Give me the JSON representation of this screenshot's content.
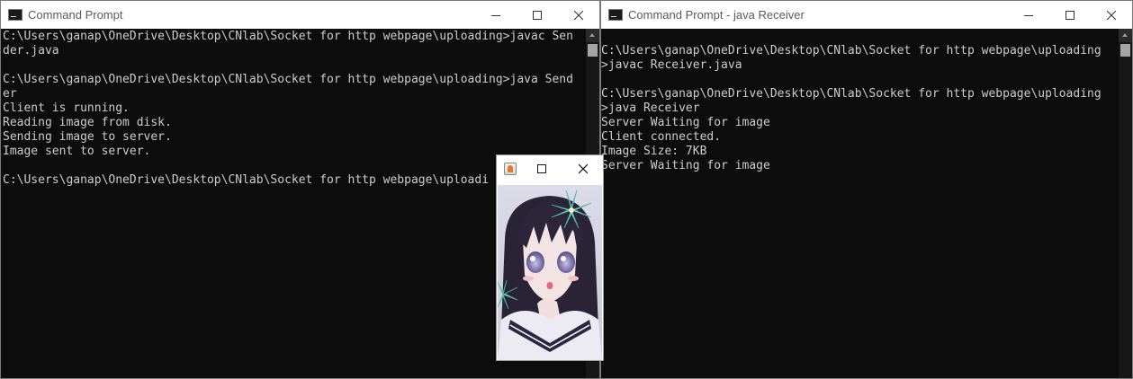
{
  "left_window": {
    "title": "Command Prompt",
    "lines": [
      "C:\\Users\\ganap\\OneDrive\\Desktop\\CNlab\\Socket for http webpage\\uploading>javac Sen",
      "der.java",
      "",
      "C:\\Users\\ganap\\OneDrive\\Desktop\\CNlab\\Socket for http webpage\\uploading>java Send",
      "er",
      "Client is running.",
      "Reading image from disk.",
      "Sending image to server.",
      "Image sent to server.",
      "",
      "C:\\Users\\ganap\\OneDrive\\Desktop\\CNlab\\Socket for http webpage\\uploadi"
    ]
  },
  "right_window": {
    "title": "Command Prompt - java  Receiver",
    "lines": [
      "",
      "C:\\Users\\ganap\\OneDrive\\Desktop\\CNlab\\Socket for http webpage\\uploading",
      ">javac Receiver.java",
      "",
      "C:\\Users\\ganap\\OneDrive\\Desktop\\CNlab\\Socket for http webpage\\uploading",
      ">java Receiver",
      "Server Waiting for image",
      "Client connected.",
      "Image Size: 7KB",
      "Server Waiting for image"
    ]
  },
  "image_window": {
    "title": "",
    "image_content": "anime-girl-with-flower"
  },
  "icons": {
    "app": "cmd-icon",
    "java": "java-icon",
    "minimize": "minimize-icon",
    "maximize": "maximize-icon",
    "close": "close-icon"
  },
  "colors": {
    "console_bg": "#0c0c0c",
    "console_text": "#cccccc",
    "titlebar_bg": "#ffffff"
  }
}
